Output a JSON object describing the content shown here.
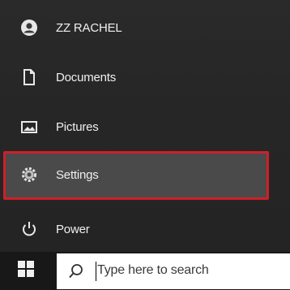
{
  "start_menu": {
    "user": {
      "name": "ZZ RACHEL",
      "icon": "user-avatar-icon"
    },
    "items": [
      {
        "label": "Documents",
        "icon": "document-icon"
      },
      {
        "label": "Pictures",
        "icon": "pictures-icon"
      },
      {
        "label": "Settings",
        "icon": "gear-icon",
        "highlighted": true
      },
      {
        "label": "Power",
        "icon": "power-icon"
      }
    ],
    "highlight_color": "#d01e2a"
  },
  "taskbar": {
    "start_icon": "windows-logo-icon",
    "search": {
      "placeholder": "Type here to search",
      "icon": "search-icon"
    }
  }
}
